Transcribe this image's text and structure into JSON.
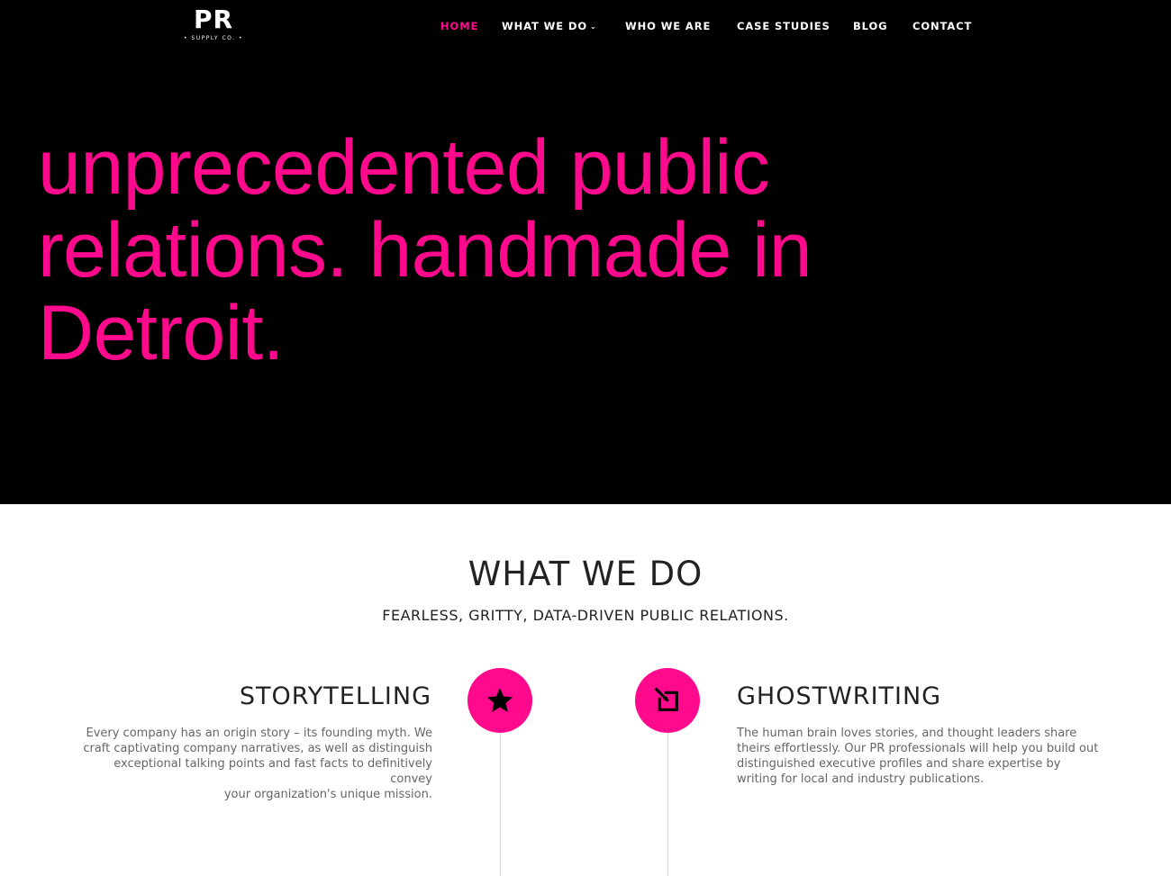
{
  "header": {
    "logo": {
      "mark": "PR",
      "sub": "• SUPPLY CO. •"
    },
    "nav": [
      {
        "label": "HOME",
        "active": true
      },
      {
        "label": "WHAT WE DO",
        "has_dropdown": true,
        "dropdown_icon": "chevron-down-icon"
      },
      {
        "label": "WHO WE ARE"
      },
      {
        "label": "CASE STUDIES"
      },
      {
        "label": "BLOG"
      },
      {
        "label": "CONTACT"
      }
    ]
  },
  "hero": {
    "lines": [
      "unprecedented public",
      "relations. handmade in",
      "Detroit."
    ]
  },
  "what_we_do": {
    "title": "WHAT WE DO",
    "subtitle": "FEARLESS, GRITTY, DATA-DRIVEN PUBLIC RELATIONS.",
    "features": [
      {
        "title": "STORYTELLING",
        "icon": "star-icon",
        "lines": [
          "Every company has an origin story – its founding myth. We",
          "craft captivating company narratives, as well as distinguish",
          "exceptional talking points and fast facts to definitively convey",
          "your organization's unique mission."
        ]
      },
      {
        "title": "GHOSTWRITING",
        "icon": "edit-icon",
        "lines": [
          "The human brain loves stories, and thought leaders share",
          "theirs effortlessly. Our PR professionals will help you build out",
          "distinguished executive profiles and share expertise by",
          "writing for local and industry publications."
        ]
      }
    ]
  },
  "colors": {
    "accent": "#ff0a8c",
    "hero_bg": "#000000",
    "heading": "#222222",
    "body_text": "#666666",
    "divider": "#d8d8d8"
  }
}
